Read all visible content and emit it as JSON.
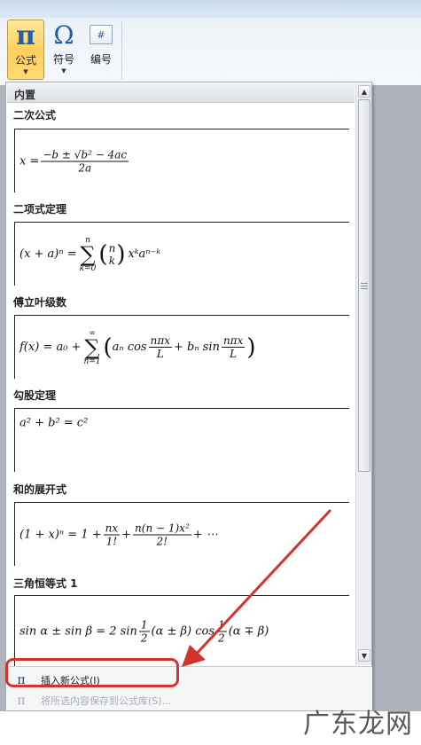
{
  "ribbon": {
    "buttons": [
      {
        "label": "公式",
        "icon": "pi-icon"
      },
      {
        "label": "符号",
        "icon": "omega-icon"
      },
      {
        "label": "编号",
        "icon": "number-icon"
      }
    ],
    "equation_glyph": "π",
    "symbol_glyph": "Ω",
    "number_glyph": "#",
    "dropdown_arrow": "▼"
  },
  "panel": {
    "header": "内置",
    "items": [
      {
        "title": "二次公式"
      },
      {
        "title": "二项式定理"
      },
      {
        "title": "傅立叶级数"
      },
      {
        "title": "勾股定理"
      },
      {
        "title": "和的展开式"
      },
      {
        "title": "三角恒等式 1"
      }
    ],
    "formulas": {
      "quadratic": {
        "lhs": "x =",
        "num": "−b ± √b² − 4ac",
        "den": "2a"
      },
      "binomial": {
        "lhs": "(x + a)ⁿ =",
        "sum_top": "n",
        "sum_bottom": "k=0",
        "binom_top": "n",
        "binom_bottom": "k",
        "rhs": "xᵏaⁿ⁻ᵏ"
      },
      "fourier": {
        "lhs": "f(x) = a₀ +",
        "sum_top": "∞",
        "sum_bottom": "n=1",
        "t1": "aₙ cos",
        "f1_num": "nπx",
        "f1_den": "L",
        "t2": "+ bₙ sin",
        "f2_num": "nπx",
        "f2_den": "L"
      },
      "pythagorean": {
        "text": "a² + b² = c²"
      },
      "expansion": {
        "lhs": "(1 + x)ⁿ = 1 +",
        "f1_num": "nx",
        "f1_den": "1!",
        "plus": "+",
        "f2_num": "n(n − 1)x²",
        "f2_den": "2!",
        "tail": "+ ⋯"
      },
      "trig": {
        "lhs": "sin α ± sin β = 2 sin",
        "f1_num": "1",
        "f1_den": "2",
        "mid": "(α ± β) cos",
        "f2_num": "1",
        "f2_den": "2",
        "tail": "(α ∓ β)"
      }
    },
    "footer": {
      "insert_label": "插入新公式(I)",
      "save_label": "将所选内容保存到公式库(S)..."
    },
    "scroll_up": "▲",
    "scroll_down": "▼"
  },
  "watermark": "广东龙网",
  "colors": {
    "accent": "#1f5fae",
    "selected_button": "#ffd977",
    "highlight": "#d2342c"
  }
}
